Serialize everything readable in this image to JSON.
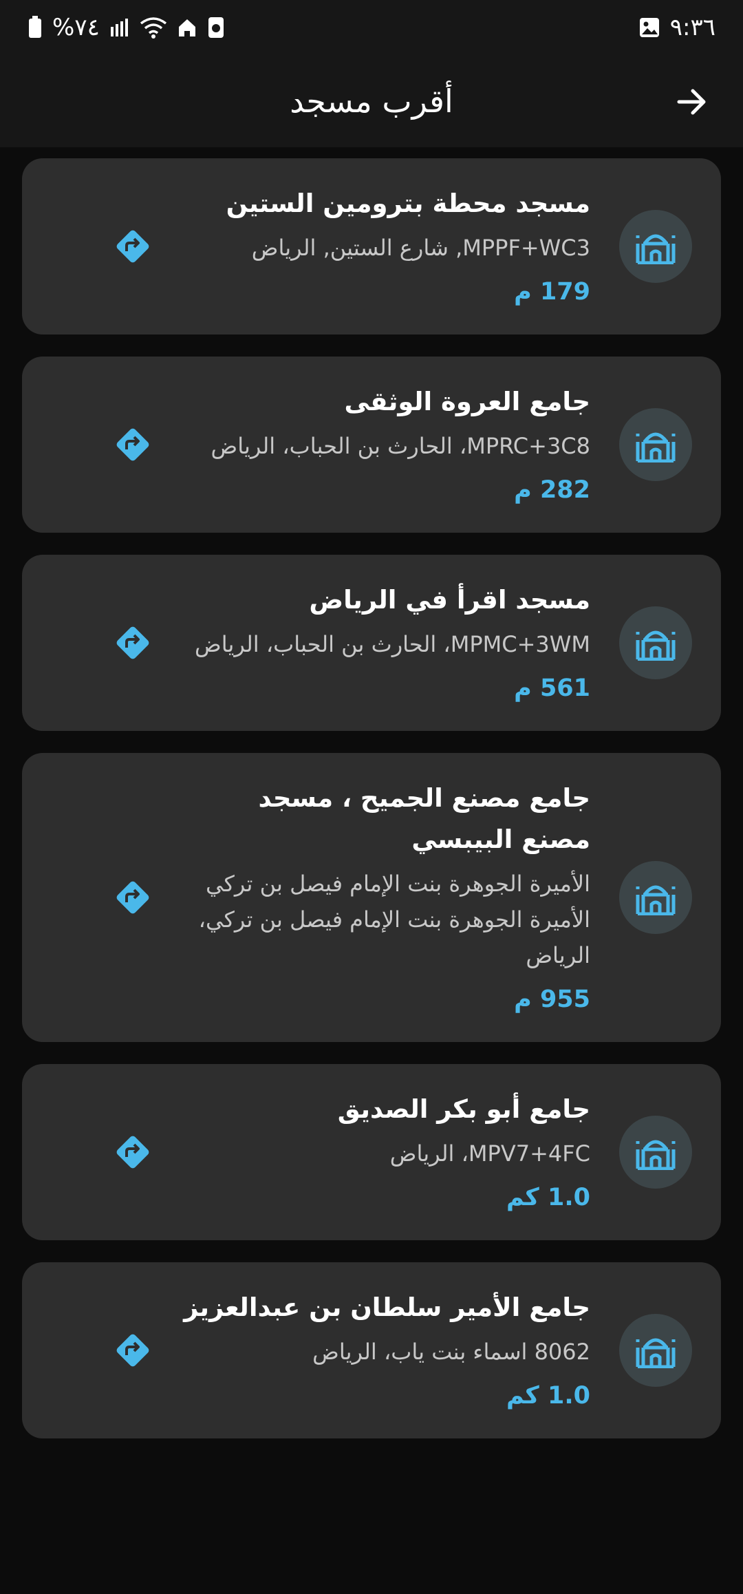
{
  "status_bar": {
    "time": "٩:٣٦",
    "battery": "%٧٤"
  },
  "header": {
    "title": "أقرب مسجد"
  },
  "colors": {
    "accent": "#4ab8ea",
    "card": "#2e2e2e",
    "background": "#0c0c0c"
  },
  "mosques": [
    {
      "name": "مسجد محطة بترومين الستين",
      "address": "MPPF+WC3, شارع الستين, الرياض",
      "distance": "179 م"
    },
    {
      "name": "جامع العروة الوثقى",
      "address": "MPRC+3C8، الحارث بن الحباب، الرياض",
      "distance": "282 م"
    },
    {
      "name": "مسجد اقرأ في الرياض",
      "address": "MPMC+3WM، الحارث بن الحباب، الرياض",
      "distance": "561 م"
    },
    {
      "name": "جامع مصنع الجميح ، مسجد مصنع البيبسي",
      "address": "الأميرة الجوهرة بنت الإمام فيصل بن تركي الأميرة الجوهرة بنت الإمام فيصل بن تركي، الرياض",
      "distance": "955 م"
    },
    {
      "name": "جامع أبو بكر الصديق",
      "address": "MPV7+4FC، الرياض",
      "distance": "1.0 كم"
    },
    {
      "name": "جامع الأمير سلطان بن عبدالعزيز",
      "address": "8062 اسماء بنت ياب، الرياض",
      "distance": "1.0 كم"
    }
  ],
  "icons": {
    "back": "arrow-right-icon",
    "mosque": "mosque-icon",
    "navigate": "directions-icon"
  }
}
